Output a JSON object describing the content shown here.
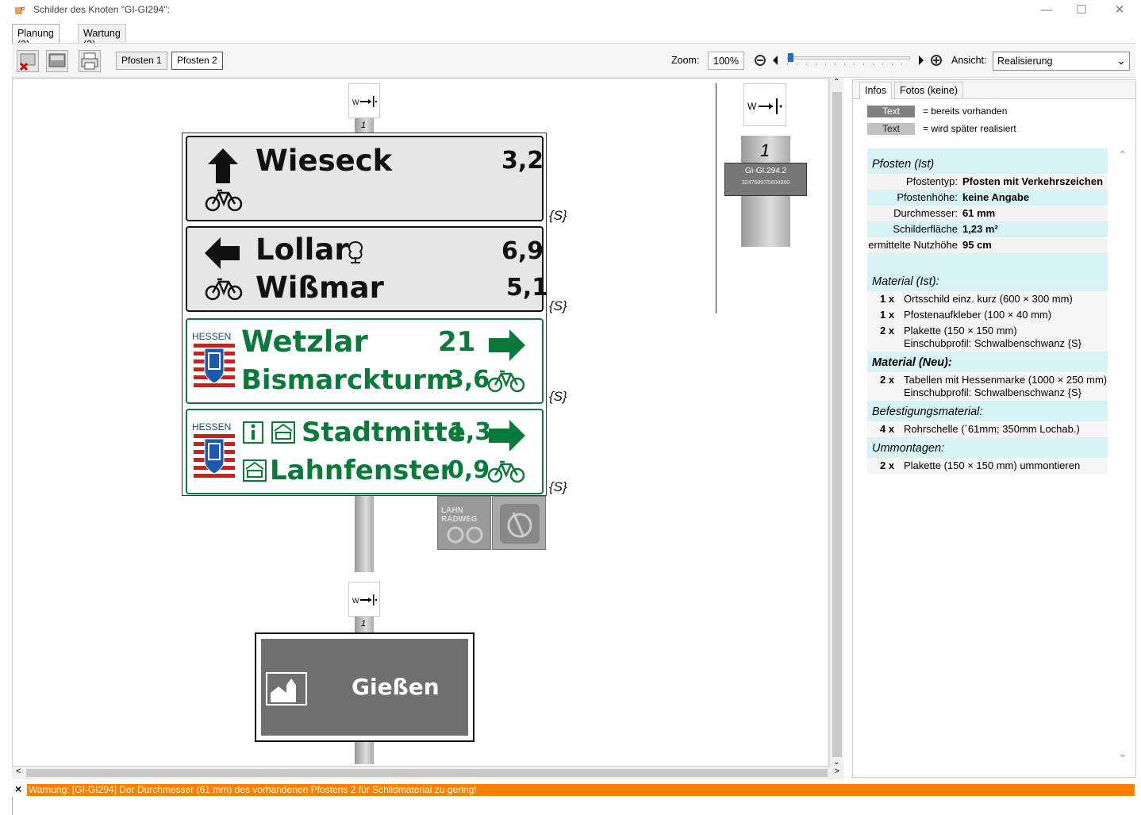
{
  "window": {
    "title": "Schilder des Knoten \"GI-GI294\":",
    "minimize": "—",
    "maximize": "☐",
    "close": "✕"
  },
  "tabs": [
    {
      "label": "Planung (2)"
    },
    {
      "label": "Wartung (2)"
    }
  ],
  "toolbar": {
    "posts": [
      "Pfosten 1",
      "Pfosten 2"
    ],
    "zoom_label": "Zoom:",
    "zoom_value": "100%",
    "view_label": "Ansicht:",
    "view_value": "Realisierung"
  },
  "signs": {
    "top_w_label": "W",
    "post_no": "1",
    "s_mark": "{S}",
    "row1": {
      "name": "Wieseck",
      "dist": "3,2"
    },
    "row2": {
      "name1": "Lollar",
      "dist1": "6,9",
      "name2": "Wißmar",
      "dist2": "5,1"
    },
    "row3": {
      "brand": "HESSEN",
      "name1": "Wetzlar",
      "dist1": "21",
      "name2": "Bismarckturm",
      "dist2": "3,6"
    },
    "row4": {
      "brand": "HESSEN",
      "name1": "Stadtmitte",
      "dist1": "1,3",
      "name2": "Lahnfenster",
      "dist2": "0,9"
    },
    "badge": "LAHN RADWEG",
    "lower_w_label": "W",
    "lower_post_no": "1",
    "town": "Gießen",
    "side_post_no": "1",
    "side_plate_id": "GI-GI.294.2",
    "side_plate_coords": "32476897/5604960"
  },
  "right_panel": {
    "tabs": [
      "Infos",
      "Fotos (keine)"
    ],
    "legend": [
      {
        "swatch": "Text",
        "desc": "= bereits vorhanden",
        "color": "#808080"
      },
      {
        "swatch": "Text",
        "desc": "= wird später realisiert",
        "color": "#c0c0c0"
      }
    ],
    "pfosten_heading": "Pfosten (Ist)",
    "pfosten_rows": [
      {
        "k": "Pfostentyp:",
        "v": "Pfosten mit Verkehrszeichen"
      },
      {
        "k": "Pfostenhöhe:",
        "v": "keine Angabe"
      },
      {
        "k": "Durchmesser:",
        "v": "61 mm"
      },
      {
        "k": "Schilderfläche",
        "v": "1,23 m²"
      },
      {
        "k": "ermittelte Nutzhöhe",
        "v": "95 cm"
      }
    ],
    "material_ist_heading": "Material (Ist):",
    "material_ist": [
      {
        "q": "1 x",
        "d": "Ortsschild einz. kurz (600 × 300 mm)"
      },
      {
        "q": "1 x",
        "d": "Pfostenaufkleber (100 × 40 mm)"
      },
      {
        "q": "2 x",
        "d": "Plakette (150 × 150 mm)\nEinschubprofil: Schwalbenschwanz {S}"
      }
    ],
    "material_neu_heading": "Material (Neu):",
    "material_neu": [
      {
        "q": "2 x",
        "d": "Tabellen mit Hessenmarke (1000 × 250 mm)\nEinschubprofil: Schwalbenschwanz {S}"
      }
    ],
    "befestigung_heading": "Befestigungsmaterial:",
    "befestigung": [
      {
        "q": "4 x",
        "d": "Rohrschelle (´61mm; 350mm Lochab.)"
      }
    ],
    "ummontagen_heading": "Ummontagen:",
    "ummontagen": [
      {
        "q": "2 x",
        "d": "Plakette (150 × 150 mm) ummontieren"
      }
    ]
  },
  "warning": {
    "text": "Warnung: [GI-GI294] Der Durchmesser (61 mm) des vorhandenen Pfostens 2 für Schildmaterial zu gering!",
    "color": "#ff7f00"
  }
}
